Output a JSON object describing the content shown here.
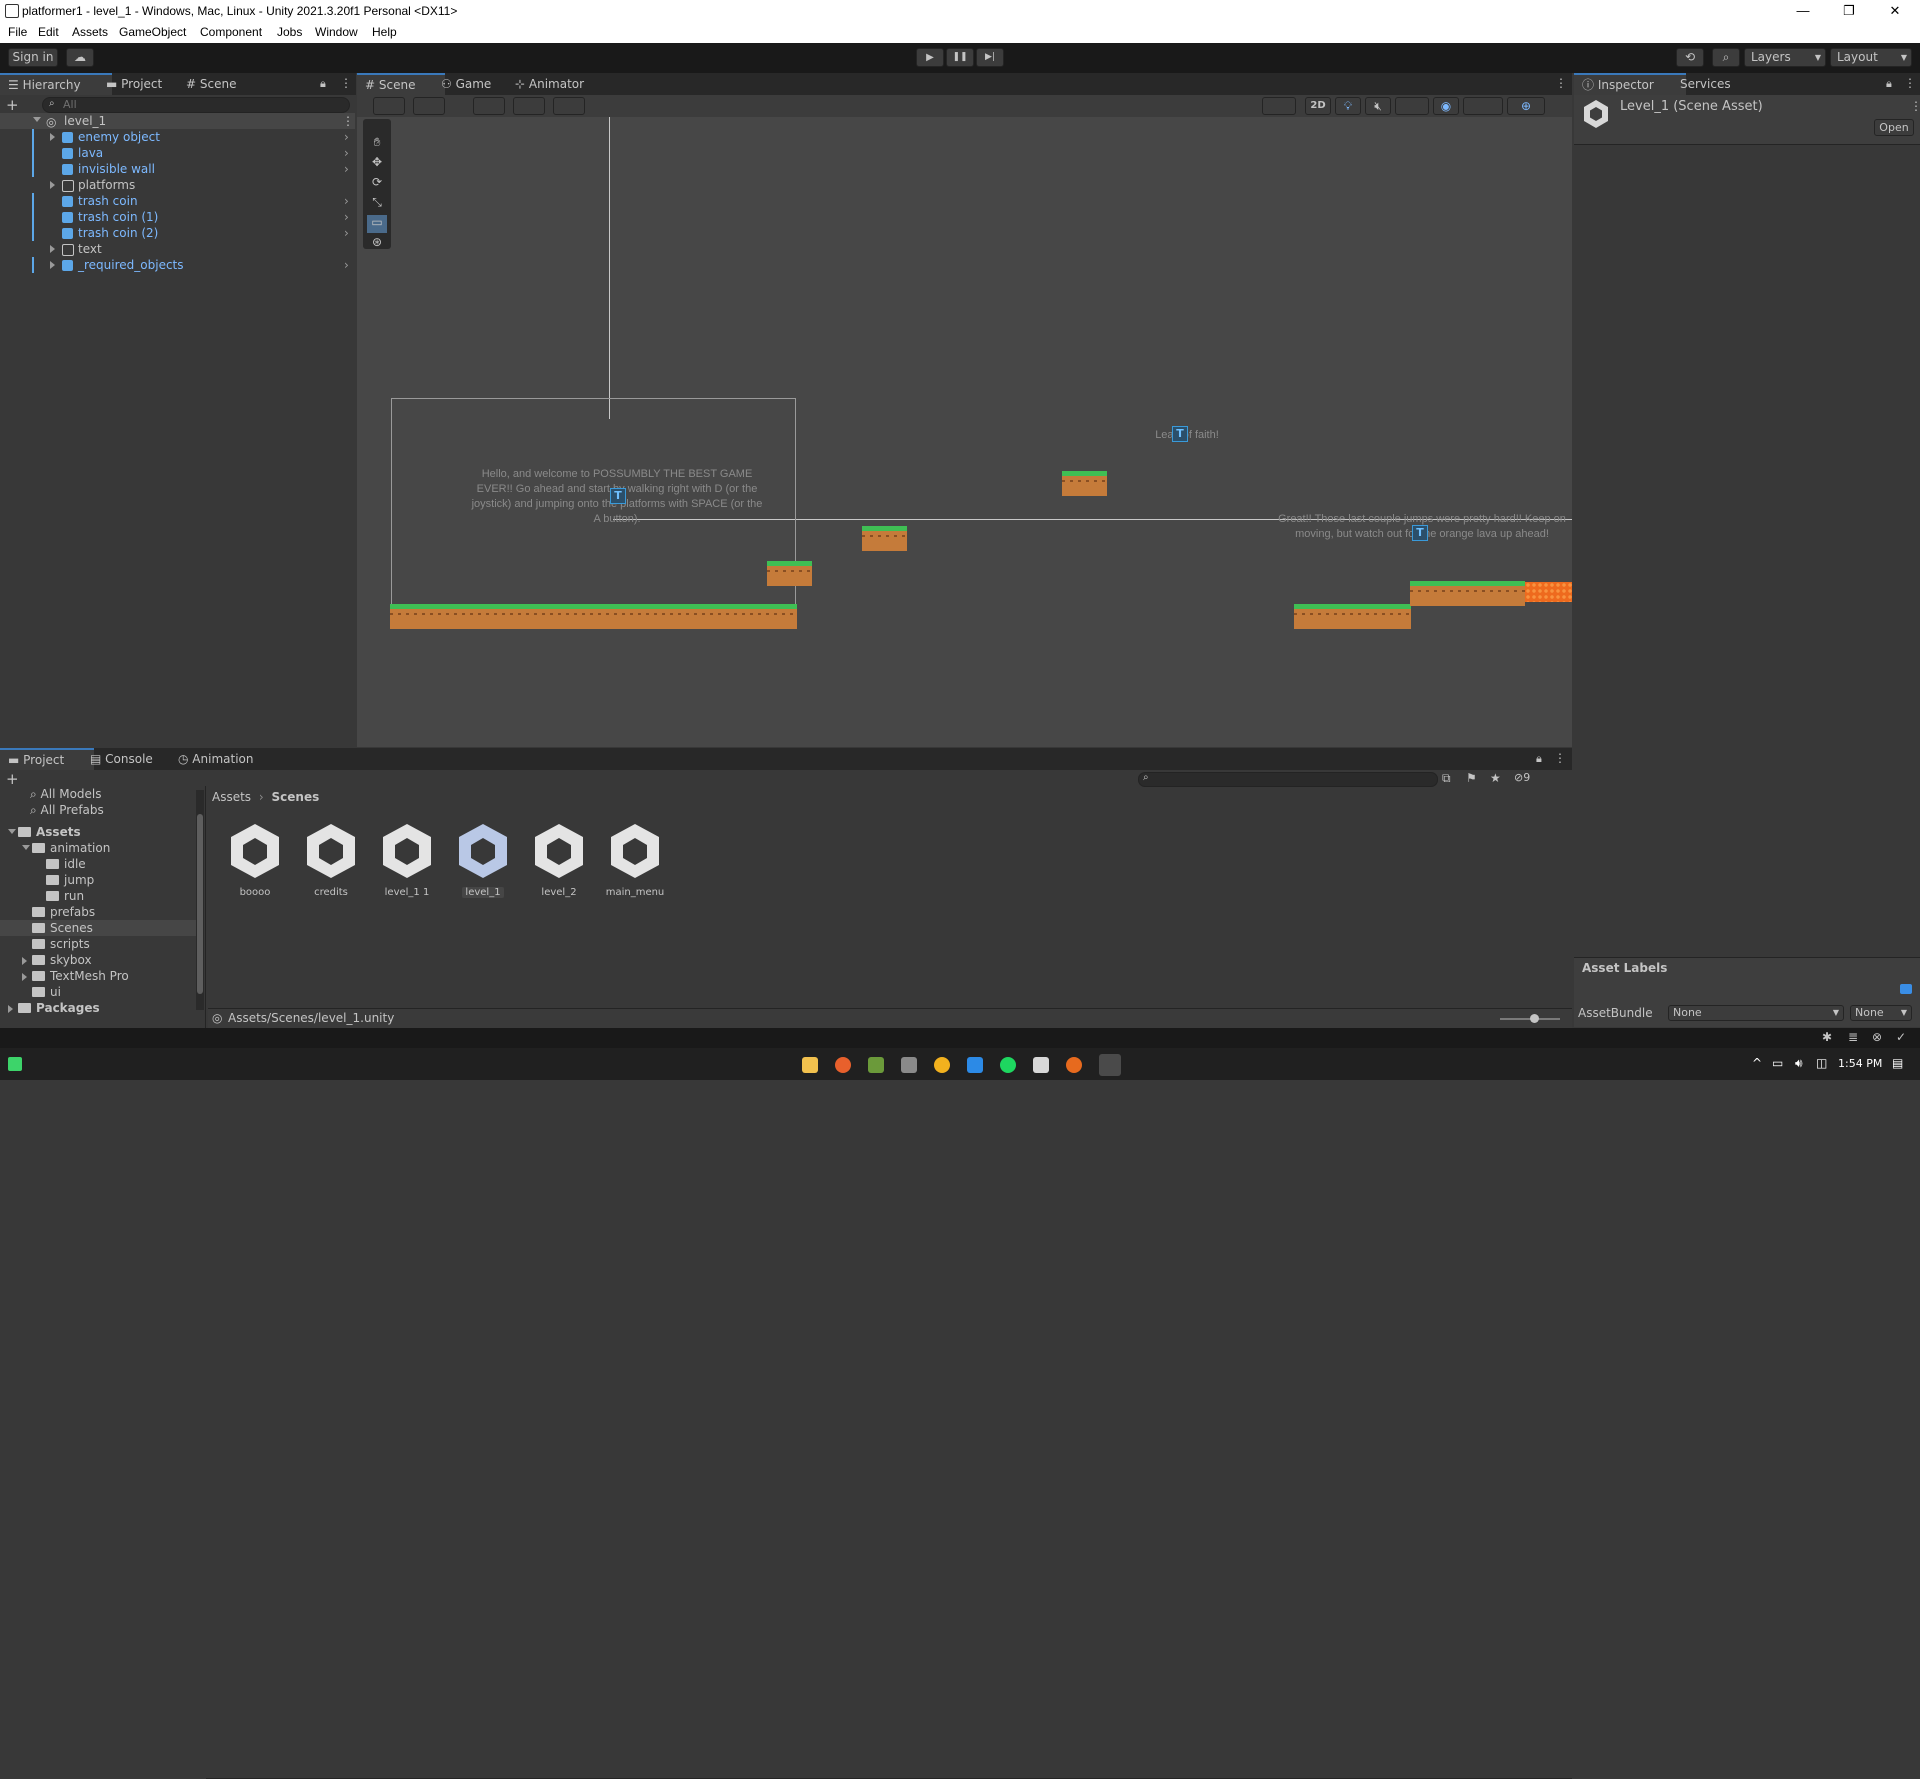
{
  "window": {
    "title": "platformer1 - level_1 - Windows, Mac, Linux - Unity 2021.3.20f1 Personal <DX11>",
    "controls": [
      "—",
      "❐",
      "✕"
    ]
  },
  "menu": [
    "File",
    "Edit",
    "Assets",
    "GameObject",
    "Component",
    "Jobs",
    "Window",
    "Help"
  ],
  "toolbar": {
    "sign_in": "Sign in",
    "play": "▶",
    "pause": "❚❚",
    "step": "▶|",
    "layers": "Layers",
    "layout": "Layout"
  },
  "left_tabs": [
    "Hierarchy",
    "Project",
    "Scene"
  ],
  "hierarchy": {
    "search_placeholder": "All",
    "root": "level_1",
    "items": [
      {
        "label": "enemy object",
        "prefab": true,
        "expandable": true
      },
      {
        "label": "lava",
        "prefab": true,
        "expandable": false
      },
      {
        "label": "invisible wall",
        "prefab": true,
        "expandable": false
      },
      {
        "label": "platforms",
        "prefab": false,
        "expandable": true
      },
      {
        "label": "trash coin",
        "prefab": true,
        "expandable": false
      },
      {
        "label": "trash coin (1)",
        "prefab": true,
        "expandable": false
      },
      {
        "label": "trash coin (2)",
        "prefab": true,
        "expandable": false
      },
      {
        "label": "text",
        "prefab": false,
        "expandable": true
      },
      {
        "label": "_required_objects",
        "prefab": true,
        "expandable": true
      }
    ]
  },
  "center_tabs": [
    "Scene",
    "Game",
    "Animator"
  ],
  "scene": {
    "toggle_2d": "2D",
    "text_intro": "Hello, and welcome to POSSUMBLY THE BEST GAME EVER!! Go ahead and start by walking right with D (or the joystick) and jumping onto the platforms with SPACE (or the A button).",
    "text_leap": "Leap of faith!",
    "text_great": "Great!! Those last couple jumps were pretty hard!! Keep on moving, but watch out for the orange lava up ahead!"
  },
  "right_tabs": [
    "Inspector",
    "Services"
  ],
  "inspector": {
    "asset_name": "Level_1 (Scene Asset)",
    "open_button": "Open",
    "asset_labels": "Asset Labels",
    "assetbundle_label": "AssetBundle",
    "assetbundle_value": "None",
    "assetbundle_variant": "None"
  },
  "bottom_tabs": [
    "Project",
    "Console",
    "Animation"
  ],
  "project": {
    "hidden_count": "9",
    "favorites": [
      "All Models",
      "All Prefabs"
    ],
    "tree": [
      {
        "label": "Assets",
        "depth": 0,
        "bold": true
      },
      {
        "label": "animation",
        "depth": 1
      },
      {
        "label": "idle",
        "depth": 2
      },
      {
        "label": "jump",
        "depth": 2
      },
      {
        "label": "run",
        "depth": 2
      },
      {
        "label": "prefabs",
        "depth": 1
      },
      {
        "label": "Scenes",
        "depth": 1,
        "selected": true
      },
      {
        "label": "scripts",
        "depth": 1
      },
      {
        "label": "skybox",
        "depth": 1
      },
      {
        "label": "TextMesh Pro",
        "depth": 1
      },
      {
        "label": "ui",
        "depth": 1
      },
      {
        "label": "Packages",
        "depth": 0,
        "bold": true
      }
    ],
    "breadcrumb": [
      "Assets",
      "Scenes"
    ],
    "assets": [
      "boooo",
      "credits",
      "level_1 1",
      "level_1",
      "level_2",
      "main_menu"
    ],
    "selected_asset": "level_1",
    "path": "Assets/Scenes/level_1.unity"
  },
  "taskbar": {
    "time": "1:54 PM"
  }
}
